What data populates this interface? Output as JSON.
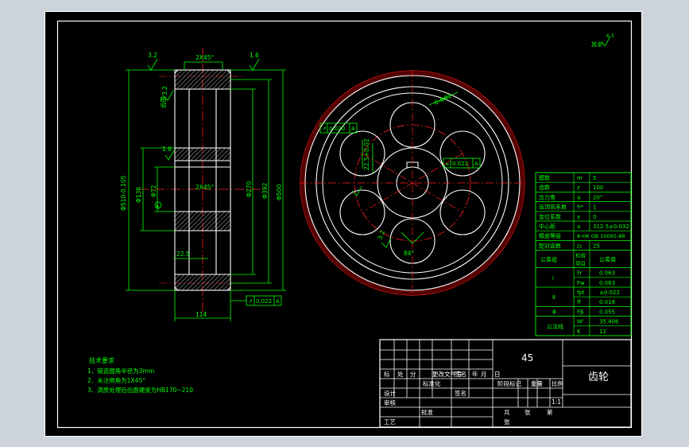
{
  "drawing": {
    "colors": {
      "background": "#000000",
      "frame": "#ffffff",
      "dimension": "#00ff00",
      "centerline": "#ff2020",
      "hatch": "#ffffff",
      "window": "#cdd3da"
    },
    "side_view": {
      "dims": {
        "top_chamfer": "2X45°",
        "mid_chamfer": "2X45°",
        "od": "Φ510-0.105",
        "bore": "Φ136",
        "hub": "Φ72",
        "web_inner": "Φ270",
        "web_outer": "Φ392",
        "rim_inner": "Φ500",
        "hole_label": "22.5",
        "width": "114",
        "rough_left": "3.2",
        "rough_right": "1.6",
        "rough_side": "3.2",
        "rough_bore": "1.6",
        "flank_label": "齿面",
        "runout_tol": "0.022",
        "runout_sym": "↗",
        "runout_datum": "A",
        "datum_mark": "A"
      }
    },
    "front_view": {
      "tol_box_1": "0.020",
      "tol_box_1_datum": "A",
      "tol_box_2": "0.022",
      "tol_box_2_datum": "A",
      "hole_dia": "6-Φ92",
      "keyway": "22.5+0.02",
      "angle": "84°",
      "rough": "3.2"
    },
    "rough_note": {
      "value": "6.3",
      "label": "其余"
    },
    "params_table": {
      "rows": [
        [
          "模数",
          "m",
          "5"
        ],
        [
          "齿数",
          "z",
          "100"
        ],
        [
          "压力角",
          "α",
          "20°"
        ],
        [
          "齿顶高系数",
          "h*",
          "1"
        ],
        [
          "变位系数",
          "x",
          "0"
        ],
        [
          "中心距",
          "a",
          "312.5±0.032"
        ],
        [
          "精度等级",
          "",
          "8-HK GB 10095-88"
        ],
        [
          "配对齿数",
          "z₂",
          "25"
        ]
      ],
      "group_header": [
        "公差组",
        "检验项目",
        "公差值"
      ],
      "groups": [
        {
          "name": "Ⅰ",
          "items": [
            [
              "Fr",
              "0.063"
            ],
            [
              "Fw",
              "0.063"
            ]
          ]
        },
        {
          "name": "Ⅱ",
          "items": [
            [
              "fpt",
              "±0.022"
            ],
            [
              "ff",
              "0.018"
            ]
          ]
        },
        {
          "name": "Ⅲ",
          "items": [
            [
              "Fβ",
              "0.055"
            ]
          ]
        },
        {
          "name": "公法线",
          "items": [
            [
              "W'",
              "35.406"
            ],
            [
              "K",
              "12"
            ]
          ]
        }
      ]
    },
    "tech_notes": {
      "title": "技术要求",
      "lines": [
        "1、锻造圆角半径为3mm",
        "2、未注倒角为1X45°",
        "3、调质处理后齿面硬度为HB170~210"
      ]
    },
    "title_block": {
      "material": "45",
      "part_name": "齿轮",
      "labels": {
        "mark": "标",
        "count": "处",
        "zone": "分",
        "doc": "更改文件号",
        "sign": "签名",
        "date_y": "年",
        "date_m": "月",
        "date_d": "日",
        "design": "设计",
        "std": "标准化",
        "stage": "阶段标记",
        "weight": "重量",
        "scale": "比例",
        "check": "审核",
        "craft": "工艺",
        "approve": "批准",
        "total": "共",
        "sheet": "张",
        "page": "第",
        "scale_val": "1:1"
      }
    }
  }
}
